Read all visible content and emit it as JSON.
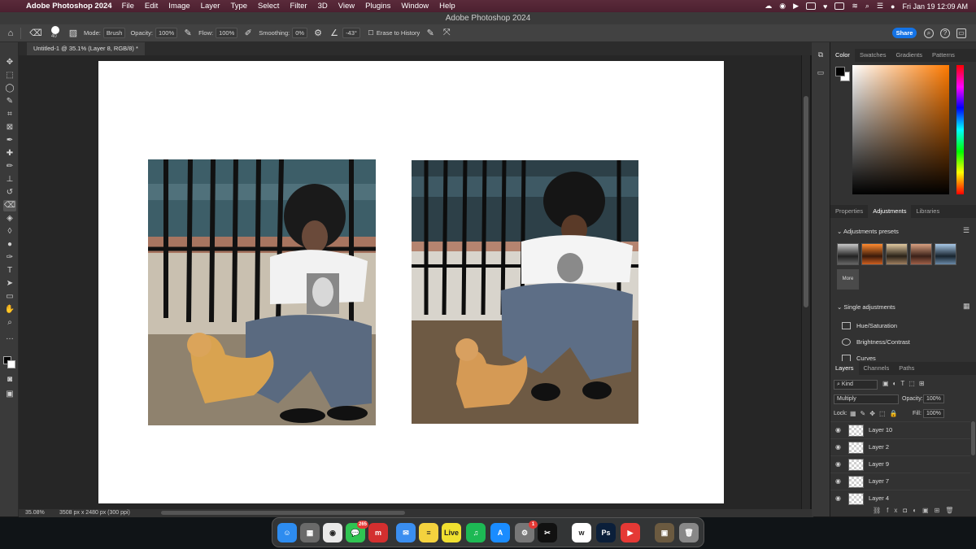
{
  "menubar": {
    "app_name": "Adobe Photoshop 2024",
    "menus": [
      "File",
      "Edit",
      "Image",
      "Layer",
      "Type",
      "Select",
      "Filter",
      "3D",
      "View",
      "Plugins",
      "Window",
      "Help"
    ],
    "clock": "Fri Jan 19  12:09 AM"
  },
  "window": {
    "title": "Adobe Photoshop 2024"
  },
  "options": {
    "brush_size": "40",
    "mode_label": "Mode:",
    "mode_value": "Brush",
    "opacity_label": "Opacity:",
    "opacity_value": "100%",
    "flow_label": "Flow:",
    "flow_value": "100%",
    "smoothing_label": "Smoothing:",
    "smoothing_value": "0%",
    "angle_value": "-43°",
    "erase_history_label": "Erase to History",
    "share_label": "Share"
  },
  "document": {
    "tab_title": "Untitled-1 @ 35.1% (Layer 8, RGB/8) *"
  },
  "status": {
    "zoom": "35.08%",
    "info": "3508 px x 2480 px (300 ppi)"
  },
  "color_panel": {
    "tabs": [
      "Color",
      "Swatches",
      "Gradients",
      "Patterns"
    ],
    "foreground": "#000000",
    "background": "#ffffff"
  },
  "adjust_panel": {
    "tabs": [
      "Properties",
      "Adjustments",
      "Libraries"
    ],
    "presets_title": "Adjustments presets",
    "more_label": "More",
    "single_title": "Single adjustments",
    "items": [
      "Hue/Saturation",
      "Brightness/Contrast",
      "Curves"
    ]
  },
  "layers_panel": {
    "tabs": [
      "Layers",
      "Channels",
      "Paths"
    ],
    "filter_kind": "Kind",
    "blend_mode": "Multiply",
    "opacity_label": "Opacity:",
    "opacity_value": "100%",
    "lock_label": "Lock:",
    "fill_label": "Fill:",
    "fill_value": "100%",
    "layers": [
      "Layer 10",
      "Layer 2",
      "Layer 9",
      "Layer 7",
      "Layer 4"
    ]
  },
  "dock": {
    "apps": [
      {
        "name": "Finder",
        "label": "☺",
        "color": "#2d8cf0"
      },
      {
        "name": "Launchpad",
        "label": "▦",
        "color": "#6a6a6a"
      },
      {
        "name": "Chrome",
        "label": "◉",
        "color": "#e9e9e9"
      },
      {
        "name": "Messages",
        "label": "💬",
        "color": "#30c452",
        "badge": "265"
      },
      {
        "name": "App",
        "label": "m",
        "color": "#d32f2f"
      },
      {
        "name": "Mail",
        "label": "✉",
        "color": "#3a8ef0"
      },
      {
        "name": "Notes",
        "label": "≡",
        "color": "#f4d23e"
      },
      {
        "name": "Live",
        "label": "Live",
        "color": "#f0e030"
      },
      {
        "name": "Spotify",
        "label": "♫",
        "color": "#1db954"
      },
      {
        "name": "App Store",
        "label": "A",
        "color": "#1a8cff"
      },
      {
        "name": "System Settings",
        "label": "⚙",
        "color": "#777777",
        "badge": "1"
      },
      {
        "name": "CapCut",
        "label": "✂",
        "color": "#111111"
      },
      {
        "name": "Webex",
        "label": "w",
        "color": "#ffffff"
      },
      {
        "name": "Photoshop",
        "label": "Ps",
        "color": "#0b1f3a"
      },
      {
        "name": "App",
        "label": "▶",
        "color": "#e53935"
      },
      {
        "name": "Photos",
        "label": "▣",
        "color": "#6b5a40"
      },
      {
        "name": "Trash",
        "label": "🗑",
        "color": "#888888"
      }
    ]
  }
}
